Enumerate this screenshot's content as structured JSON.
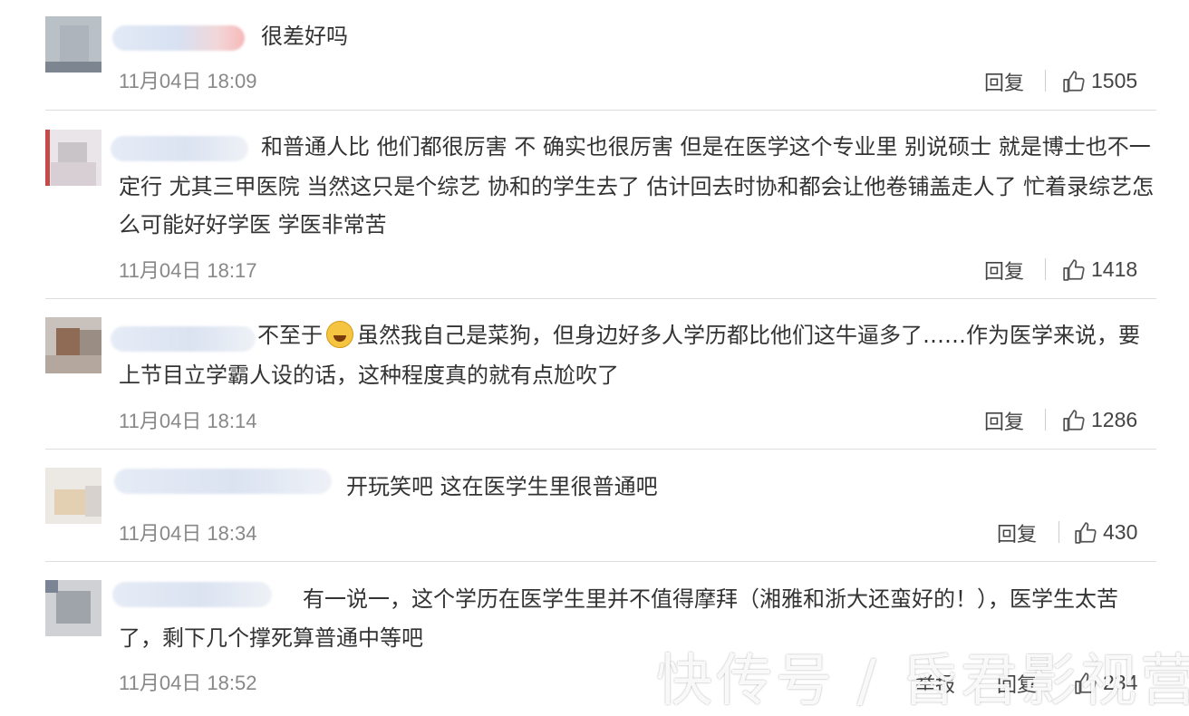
{
  "comments": [
    {
      "lines": [
        "很差好吗"
      ],
      "time": "11月04日 18:09",
      "reply": "回复",
      "likes": "1505"
    },
    {
      "lines": [
        "和普通人比 他们都很厉害 不 确实也很厉害 但是在医学这个专业里 别说硕士 就是博士也不一",
        "定行 尤其三甲医院 当然这只是个综艺 协和的学生去了 估计回去时协和都会让他卷铺盖走人了 忙着录综艺怎",
        "么可能好好学医 学医非常苦"
      ],
      "time": "11月04日 18:17",
      "reply": "回复",
      "likes": "1418"
    },
    {
      "line1_before": "不至于",
      "emoji": "laughing-crying-emoji",
      "line1_after": "虽然我自己是菜狗，但身边好多人学历都比他们这牛逼多了……作为医学来说，要",
      "line2": "上节目立学霸人设的话，这种程度真的就有点尬吹了",
      "time": "11月04日 18:14",
      "reply": "回复",
      "likes": "1286"
    },
    {
      "lines": [
        "开玩笑吧 这在医学生里很普通吧"
      ],
      "time": "11月04日 18:34",
      "reply": "回复",
      "likes": "430"
    },
    {
      "lines": [
        "有一说一，这个学历在医学生里并不值得摩拜（湘雅和浙大还蛮好的！），医学生太苦",
        "了，剩下几个撑死算普通中等吧"
      ],
      "time": "11月04日 18:52",
      "report": "举报",
      "reply": "回复",
      "likes": "234"
    }
  ],
  "watermark": "快传号 / 昏君影视营",
  "colors": {
    "text": "#333333",
    "time": "#888888",
    "divider": "#dedede"
  }
}
